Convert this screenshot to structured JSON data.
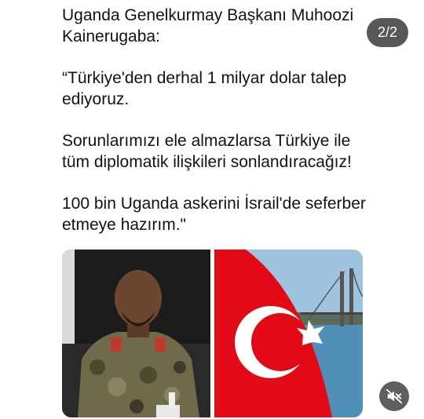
{
  "post": {
    "paragraphs": [
      "Uganda Genelkurmay Başkanı Muhoozi Kainerugaba:",
      "“Türkiye'den derhal 1 milyar dolar talep ediyoruz.",
      "Sorunlarımızı ele almazlarsa Türkiye ile tüm diplomatik ilişkileri sonlandıracağız!",
      "100 bin Uganda askerini İsrail'de seferber etmeye hazırım.\""
    ]
  },
  "pager": {
    "label": "2/2"
  },
  "media": [
    {
      "name": "general-photo"
    },
    {
      "name": "turkish-flag-photo"
    }
  ],
  "controls": {
    "mute_icon": "speaker-muted-icon"
  },
  "colors": {
    "flag_red": "#e30a17",
    "pager_bg": "#585858",
    "mute_bg": "#5f5f5f"
  }
}
